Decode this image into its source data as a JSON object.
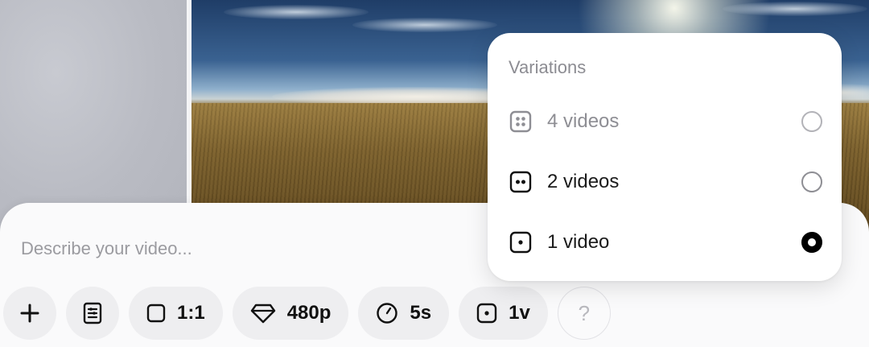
{
  "prompt": {
    "placeholder": "Describe your video..."
  },
  "toolbar": {
    "aspect_label": "1:1",
    "resolution_label": "480p",
    "duration_label": "5s",
    "variations_label": "1v",
    "help_label": "?"
  },
  "variations_menu": {
    "title": "Variations",
    "options": [
      {
        "label": "4 videos",
        "icon": "four-dots-icon",
        "disabled": true,
        "selected": false
      },
      {
        "label": "2 videos",
        "icon": "two-dots-icon",
        "disabled": false,
        "selected": false
      },
      {
        "label": "1 video",
        "icon": "one-dot-icon",
        "disabled": false,
        "selected": true
      }
    ]
  }
}
